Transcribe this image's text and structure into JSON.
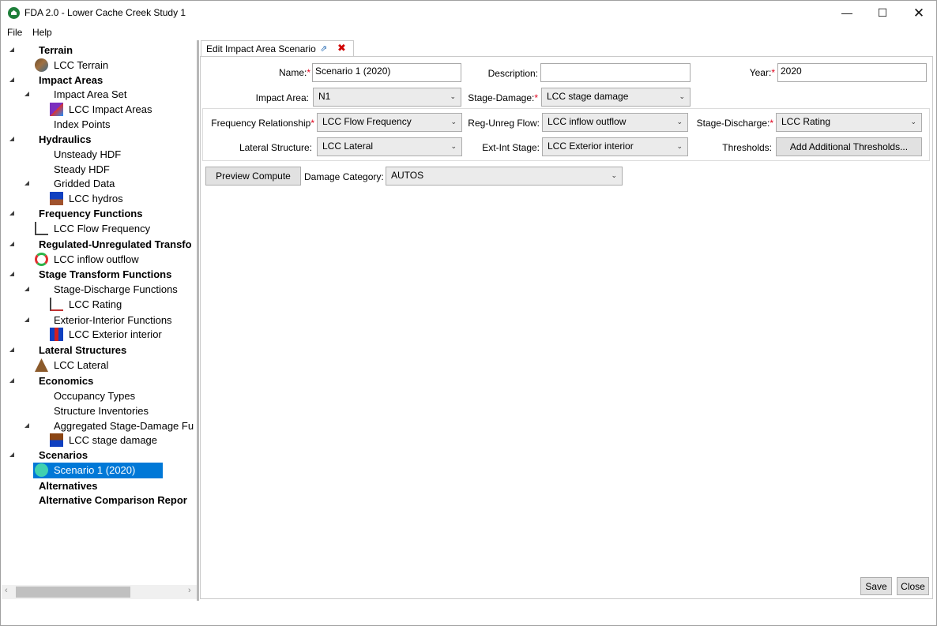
{
  "window": {
    "title": "FDA 2.0 - Lower Cache Creek Study 1",
    "min_glyph": "—",
    "max_glyph": "☐",
    "close_glyph": "✕"
  },
  "menu": {
    "file": "File",
    "help": "Help"
  },
  "tree": [
    {
      "label": "Terrain",
      "bold": true
    },
    {
      "label": "LCC Terrain",
      "icon": "terrain-icon"
    },
    {
      "label": "Impact Areas",
      "bold": true
    },
    {
      "label": "Impact Area Set"
    },
    {
      "label": "LCC Impact Areas",
      "icon": "impact-area-icon"
    },
    {
      "label": "Index Points"
    },
    {
      "label": "Hydraulics",
      "bold": true
    },
    {
      "label": "Unsteady HDF"
    },
    {
      "label": "Steady HDF"
    },
    {
      "label": "Gridded Data"
    },
    {
      "label": "LCC hydros",
      "icon": "hydraulics-icon"
    },
    {
      "label": "Frequency Functions",
      "bold": true
    },
    {
      "label": "LCC Flow Frequency",
      "icon": "frequency-curve-icon"
    },
    {
      "label": "Regulated-Unregulated Transfo",
      "bold": true
    },
    {
      "label": "LCC inflow outflow",
      "icon": "inflow-outflow-icon"
    },
    {
      "label": "Stage Transform Functions",
      "bold": true
    },
    {
      "label": "Stage-Discharge Functions"
    },
    {
      "label": "LCC Rating",
      "icon": "rating-curve-icon"
    },
    {
      "label": "Exterior-Interior Functions"
    },
    {
      "label": "LCC Exterior interior",
      "icon": "exterior-interior-icon"
    },
    {
      "label": "Lateral Structures",
      "bold": true
    },
    {
      "label": "LCC Lateral",
      "icon": "levee-icon"
    },
    {
      "label": "Economics",
      "bold": true
    },
    {
      "label": "Occupancy Types"
    },
    {
      "label": "Structure Inventories"
    },
    {
      "label": "Aggregated Stage-Damage Fu"
    },
    {
      "label": "LCC stage damage",
      "icon": "stage-damage-icon"
    },
    {
      "label": "Scenarios",
      "bold": true
    },
    {
      "label": "Scenario 1 (2020)",
      "icon": "scenario-icon",
      "selected": true
    },
    {
      "label": "Alternatives",
      "bold": true
    },
    {
      "label": "Alternative Comparison Repor",
      "bold": true
    }
  ],
  "tab": {
    "label": "Edit Impact Area Scenario",
    "popout_glyph": "⇗",
    "close_glyph": "✖"
  },
  "form": {
    "name_label": "Name:",
    "name_value": "Scenario 1 (2020)",
    "description_label": "Description:",
    "description_value": "",
    "year_label": "Year:",
    "year_value": "2020",
    "impact_area_label": "Impact Area:",
    "impact_area_value": "N1",
    "stage_damage_label": "Stage-Damage:",
    "stage_damage_value": "LCC stage damage",
    "freq_label": "Frequency Relationship",
    "freq_value": "LCC Flow Frequency",
    "reg_unreg_label": "Reg-Unreg Flow:",
    "reg_unreg_value": "LCC inflow outflow",
    "stage_discharge_label": "Stage-Discharge:",
    "stage_discharge_value": "LCC Rating",
    "lateral_label": "Lateral Structure:",
    "lateral_value": "LCC Lateral",
    "ext_int_label": "Ext-Int Stage:",
    "ext_int_value": "LCC Exterior interior",
    "thresholds_label": "Thresholds:",
    "thresholds_button": "Add Additional Thresholds...",
    "preview_button": "Preview Compute",
    "damage_category_label": "Damage Category:",
    "damage_category_value": "AUTOS",
    "required_mark": "*",
    "dropdown_glyph": "⌄"
  },
  "footer": {
    "save": "Save",
    "close": "Close"
  },
  "scroll": {
    "left_glyph": "‹",
    "right_glyph": "›"
  },
  "colors": {
    "selection": "#0078d7",
    "required": "#e0001b",
    "app_icon": "#1e7f3a"
  }
}
